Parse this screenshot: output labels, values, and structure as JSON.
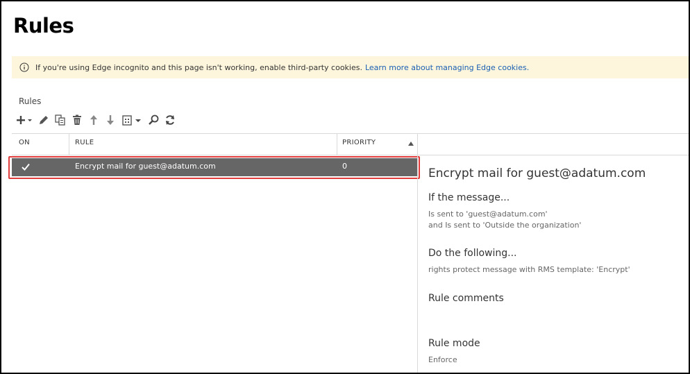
{
  "page": {
    "title": "Rules"
  },
  "banner": {
    "message": "If you're using Edge incognito and this page isn't working, enable third-party cookies.",
    "link": "Learn more about managing Edge cookies."
  },
  "section": {
    "label": "Rules"
  },
  "toolbar": {
    "icons": [
      "add-icon",
      "edit-icon",
      "copy-icon",
      "delete-icon",
      "move-up-icon",
      "move-down-icon",
      "export-icon",
      "search-icon",
      "refresh-icon"
    ]
  },
  "table": {
    "columns": [
      "ON",
      "RULE",
      "PRIORITY"
    ],
    "rows": [
      {
        "on": true,
        "rule": "Encrypt mail for guest@adatum.com",
        "priority": "0"
      }
    ]
  },
  "details": {
    "title": "Encrypt mail for guest@adatum.com",
    "if_heading": "If the message...",
    "if_line1": "Is sent to 'guest@adatum.com'",
    "if_line2": "and Is sent to 'Outside the organization'",
    "do_heading": "Do the following...",
    "do_line1": "rights protect message with RMS template:  'Encrypt'",
    "comments_heading": "Rule comments",
    "mode_heading": "Rule mode",
    "mode_value": "Enforce"
  },
  "colors": {
    "selected_row": "#666666",
    "highlight": "#e03c3c",
    "banner_bg": "#fdf6dc",
    "link": "#1a5fb4"
  }
}
